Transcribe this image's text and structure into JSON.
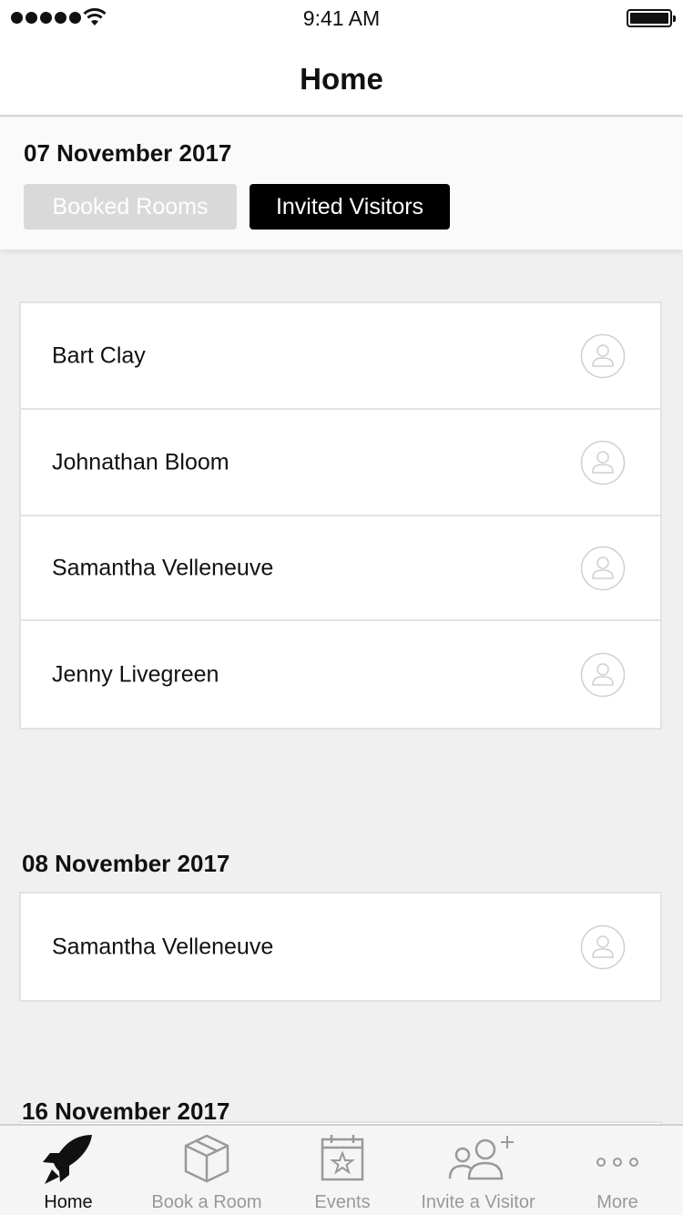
{
  "status_bar": {
    "time": "9:41 AM"
  },
  "nav": {
    "title": "Home"
  },
  "header": {
    "date": "07 November 2017",
    "segments": [
      {
        "label": "Booked Rooms",
        "active": false
      },
      {
        "label": "Invited Visitors",
        "active": true
      }
    ]
  },
  "sections": [
    {
      "visitors": [
        {
          "name": "Bart Clay"
        },
        {
          "name": "Johnathan Bloom"
        },
        {
          "name": "Samantha Velleneuve"
        },
        {
          "name": "Jenny Livegreen"
        }
      ]
    },
    {
      "date": "08 November 2017",
      "visitors": [
        {
          "name": "Samantha Velleneuve"
        }
      ]
    },
    {
      "date": "16 November 2017",
      "visitors": []
    }
  ],
  "tab_bar": {
    "tabs": [
      {
        "label": "Home",
        "icon": "rocket-icon",
        "active": true
      },
      {
        "label": "Book a Room",
        "icon": "box-icon",
        "active": false
      },
      {
        "label": "Events",
        "icon": "calendar-star-icon",
        "active": false
      },
      {
        "label": "Invite a Visitor",
        "icon": "add-people-icon",
        "active": false
      },
      {
        "label": "More",
        "icon": "more-dots-icon",
        "active": false
      }
    ]
  },
  "colors": {
    "active_segment": "#000000",
    "inactive_segment": "#d9d9d9",
    "background": "#f0f0f0"
  }
}
